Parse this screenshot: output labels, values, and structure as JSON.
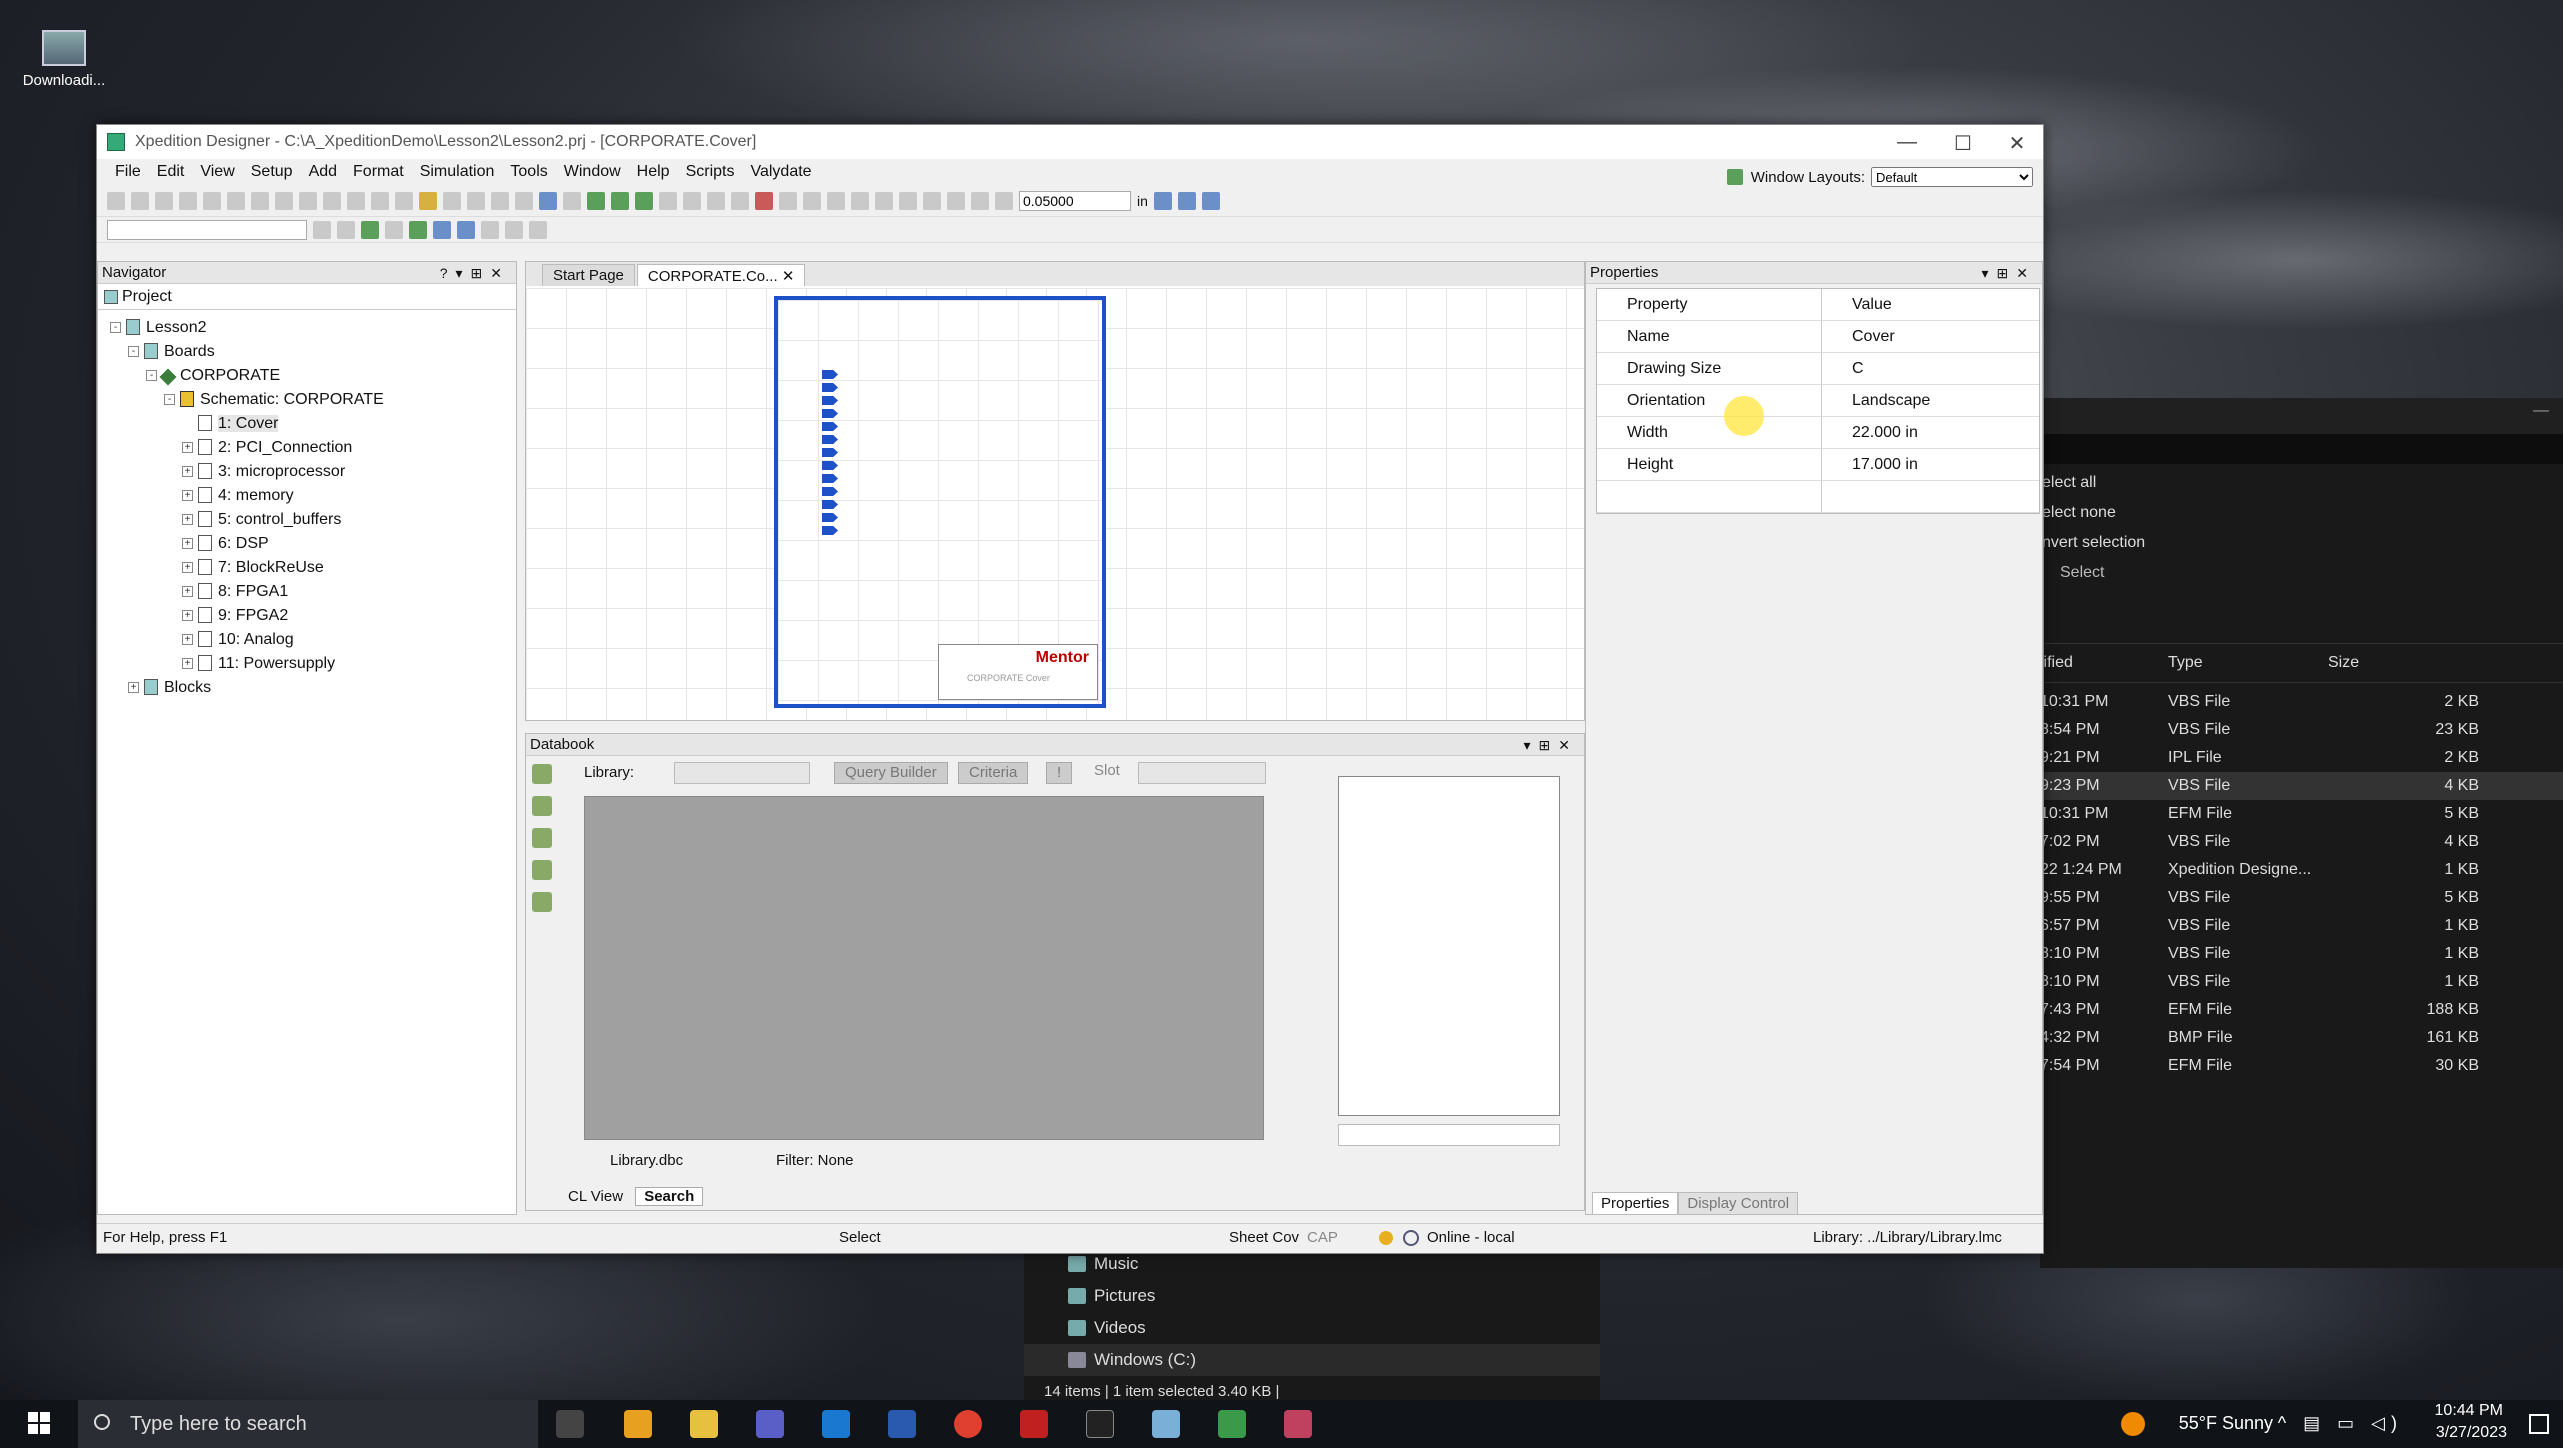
{
  "desktop": {
    "icon_label": "Downloadi..."
  },
  "window": {
    "title": "Xpedition Designer - C:\\A_XpeditionDemo\\Lesson2\\Lesson2.prj - [CORPORATE.Cover]",
    "menu": [
      "File",
      "Edit",
      "View",
      "Setup",
      "Add",
      "Format",
      "Simulation",
      "Tools",
      "Window",
      "Help",
      "Scripts",
      "Valydate"
    ],
    "window_layouts_label": "Window Layouts:",
    "window_layouts_value": "Default",
    "grid_value": "0.05000",
    "grid_unit": "in"
  },
  "navigator": {
    "title": "Navigator",
    "tab": "Project",
    "tree": [
      {
        "label": "Lesson2",
        "level": 0,
        "icon": "project-icon",
        "exp": "-"
      },
      {
        "label": "Boards",
        "level": 1,
        "icon": "boards-icon",
        "exp": "-"
      },
      {
        "label": "CORPORATE",
        "level": 2,
        "icon": "board-icon",
        "exp": "-"
      },
      {
        "label": "Schematic: CORPORATE",
        "level": 3,
        "icon": "schematic-icon",
        "exp": "-"
      },
      {
        "label": "1: Cover",
        "level": 4,
        "icon": "sheet-icon",
        "exp": "",
        "selected": true
      },
      {
        "label": "2: PCI_Connection",
        "level": 4,
        "icon": "sheet-icon",
        "exp": "+"
      },
      {
        "label": "3: microprocessor",
        "level": 4,
        "icon": "sheet-icon",
        "exp": "+"
      },
      {
        "label": "4: memory",
        "level": 4,
        "icon": "sheet-icon",
        "exp": "+"
      },
      {
        "label": "5: control_buffers",
        "level": 4,
        "icon": "sheet-icon",
        "exp": "+"
      },
      {
        "label": "6: DSP",
        "level": 4,
        "icon": "sheet-icon",
        "exp": "+"
      },
      {
        "label": "7: BlockReUse",
        "level": 4,
        "icon": "sheet-icon",
        "exp": "+"
      },
      {
        "label": "8: FPGA1",
        "level": 4,
        "icon": "sheet-icon",
        "exp": "+"
      },
      {
        "label": "9: FPGA2",
        "level": 4,
        "icon": "sheet-icon",
        "exp": "+"
      },
      {
        "label": "10: Analog",
        "level": 4,
        "icon": "sheet-icon",
        "exp": "+"
      },
      {
        "label": "11: Powersupply",
        "level": 4,
        "icon": "sheet-icon",
        "exp": "+"
      },
      {
        "label": "Blocks",
        "level": 1,
        "icon": "blocks-icon",
        "exp": "+"
      }
    ]
  },
  "editor": {
    "tabs": [
      {
        "label": "Start Page",
        "active": false
      },
      {
        "label": "CORPORATE.Co...",
        "active": true
      }
    ],
    "title_block": "Mentor",
    "title_block_sub": "CORPORATE Cover"
  },
  "databook": {
    "title": "Databook",
    "library_label": "Library:",
    "query_builder": "Query Builder",
    "criteria": "Criteria",
    "bang": "!",
    "slot_label": "Slot",
    "library_file": "Library.dbc",
    "filter": "Filter: None",
    "tabs": [
      "CL View",
      "Search"
    ]
  },
  "properties": {
    "title": "Properties",
    "col_property": "Property",
    "col_value": "Value",
    "rows": [
      {
        "k": "Name",
        "v": "Cover"
      },
      {
        "k": "Drawing Size",
        "v": "C"
      },
      {
        "k": "Orientation",
        "v": "Landscape"
      },
      {
        "k": "Width",
        "v": "22.000 in"
      },
      {
        "k": "Height",
        "v": "17.000 in"
      }
    ],
    "tab_properties": "Properties",
    "tab_display": "Display Control"
  },
  "status": {
    "help": "For Help, press F1",
    "mode": "Select",
    "sheet": "Sheet Cov",
    "caps": "CAP",
    "online": "Online - local",
    "library": "Library: ../Library/Library.lmc"
  },
  "explorer": {
    "menu": [
      "elect all",
      "elect none",
      "nvert selection",
      "Select"
    ],
    "cols": [
      "lified",
      "Type",
      "Size"
    ],
    "rows": [
      {
        "d": "10:31 PM",
        "t": "VBS File",
        "s": "2 KB"
      },
      {
        "d": "8:54 PM",
        "t": "VBS File",
        "s": "23 KB"
      },
      {
        "d": "9:21 PM",
        "t": "IPL File",
        "s": "2 KB"
      },
      {
        "d": "9:23 PM",
        "t": "VBS File",
        "s": "4 KB",
        "sel": true
      },
      {
        "d": "10:31 PM",
        "t": "EFM File",
        "s": "5 KB"
      },
      {
        "d": "7:02 PM",
        "t": "VBS File",
        "s": "4 KB"
      },
      {
        "d": "22 1:24 PM",
        "t": "Xpedition Designe...",
        "s": "1 KB"
      },
      {
        "d": "9:55 PM",
        "t": "VBS File",
        "s": "5 KB"
      },
      {
        "d": "6:57 PM",
        "t": "VBS File",
        "s": "1 KB"
      },
      {
        "d": "8:10 PM",
        "t": "VBS File",
        "s": "1 KB"
      },
      {
        "d": "8:10 PM",
        "t": "VBS File",
        "s": "1 KB"
      },
      {
        "d": "7:43 PM",
        "t": "EFM File",
        "s": "188 KB"
      },
      {
        "d": "4:32 PM",
        "t": "BMP File",
        "s": "161 KB"
      },
      {
        "d": "7:54 PM",
        "t": "EFM File",
        "s": "30 KB"
      }
    ],
    "nav": [
      "Music",
      "Pictures",
      "Videos",
      "Windows (C:)"
    ],
    "status": "14 items  |  1 item selected  3.40 KB  |"
  },
  "taskbar": {
    "search_placeholder": "Type here to search",
    "weather": "55°F  Sunny",
    "time": "10:44 PM",
    "date": "3/27/2023"
  }
}
